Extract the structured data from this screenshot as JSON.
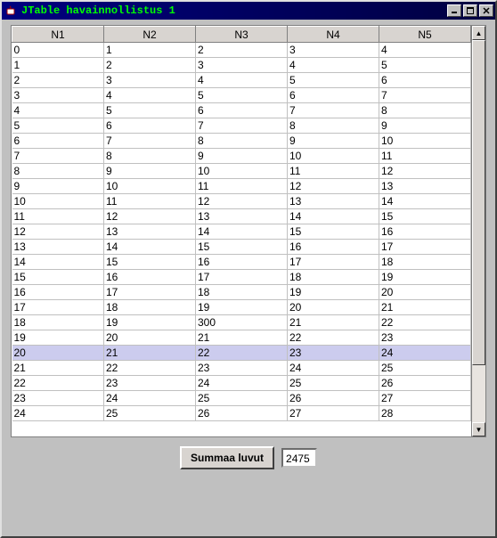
{
  "window": {
    "title": "JTable havainnollistus 1"
  },
  "titlebar_buttons": {
    "minimize": "_",
    "maximize": "□",
    "close": "×"
  },
  "table": {
    "headers": [
      "N1",
      "N2",
      "N3",
      "N4",
      "N5"
    ],
    "selected_index": 20,
    "rows": [
      [
        "0",
        "1",
        "2",
        "3",
        "4"
      ],
      [
        "1",
        "2",
        "3",
        "4",
        "5"
      ],
      [
        "2",
        "3",
        "4",
        "5",
        "6"
      ],
      [
        "3",
        "4",
        "5",
        "6",
        "7"
      ],
      [
        "4",
        "5",
        "6",
        "7",
        "8"
      ],
      [
        "5",
        "6",
        "7",
        "8",
        "9"
      ],
      [
        "6",
        "7",
        "8",
        "9",
        "10"
      ],
      [
        "7",
        "8",
        "9",
        "10",
        "11"
      ],
      [
        "8",
        "9",
        "10",
        "11",
        "12"
      ],
      [
        "9",
        "10",
        "11",
        "12",
        "13"
      ],
      [
        "10",
        "11",
        "12",
        "13",
        "14"
      ],
      [
        "11",
        "12",
        "13",
        "14",
        "15"
      ],
      [
        "12",
        "13",
        "14",
        "15",
        "16"
      ],
      [
        "13",
        "14",
        "15",
        "16",
        "17"
      ],
      [
        "14",
        "15",
        "16",
        "17",
        "18"
      ],
      [
        "15",
        "16",
        "17",
        "18",
        "19"
      ],
      [
        "16",
        "17",
        "18",
        "19",
        "20"
      ],
      [
        "17",
        "18",
        "19",
        "20",
        "21"
      ],
      [
        "18",
        "19",
        "300",
        "21",
        "22"
      ],
      [
        "19",
        "20",
        "21",
        "22",
        "23"
      ],
      [
        "20",
        "21",
        "22",
        "23",
        "24"
      ],
      [
        "21",
        "22",
        "23",
        "24",
        "25"
      ],
      [
        "22",
        "23",
        "24",
        "25",
        "26"
      ],
      [
        "23",
        "24",
        "25",
        "26",
        "27"
      ],
      [
        "24",
        "25",
        "26",
        "27",
        "28"
      ]
    ]
  },
  "controls": {
    "sum_button_label": "Summaa luvut",
    "sum_value": "2475"
  },
  "scroll": {
    "up": "▲",
    "down": "▼"
  }
}
